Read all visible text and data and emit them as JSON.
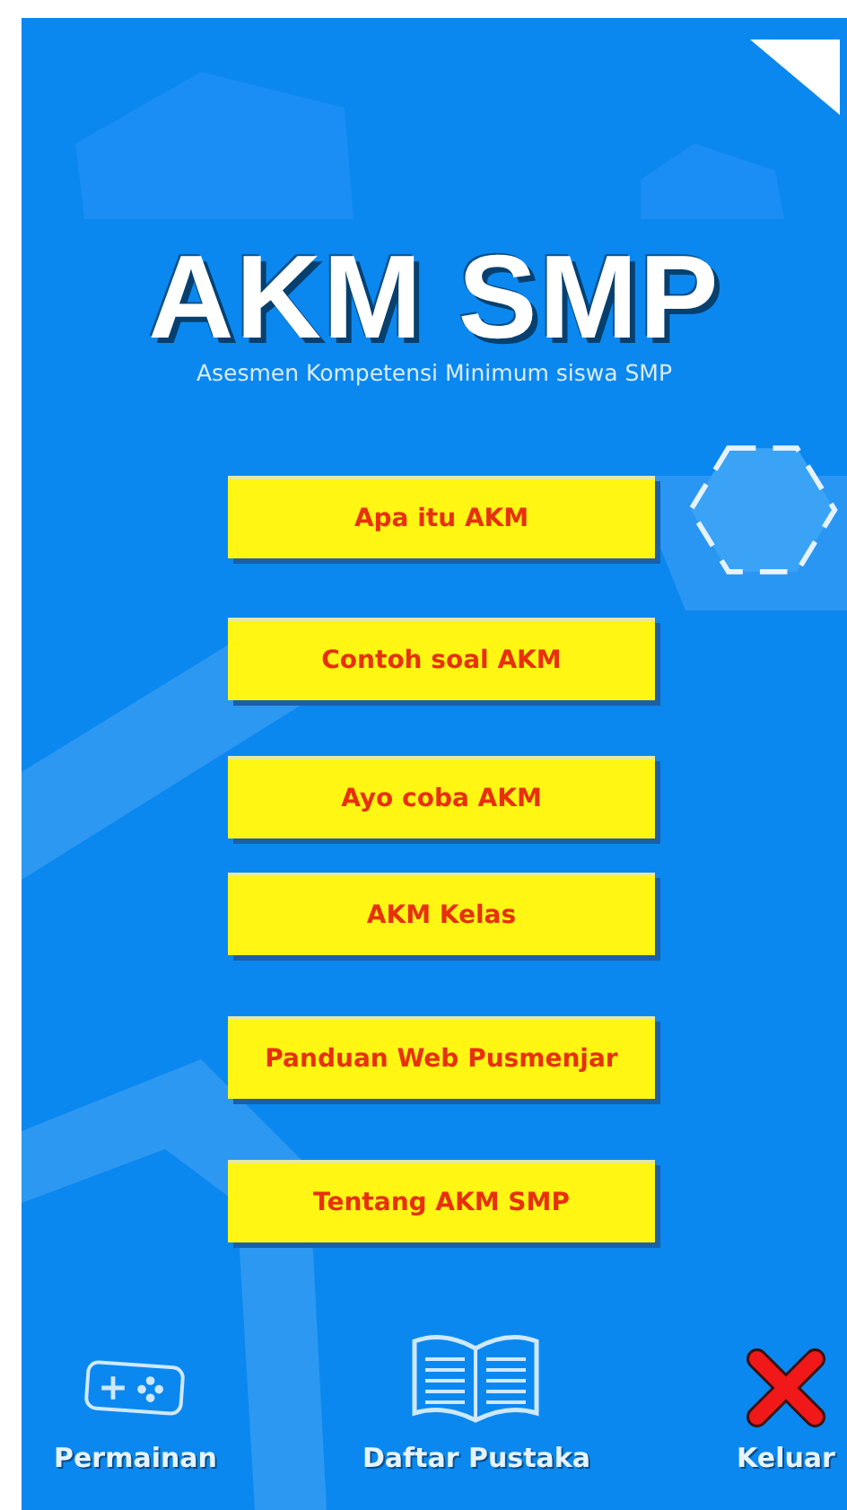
{
  "app": {
    "title": "AKM SMP",
    "subtitle": "Asesmen Kompetensi Minimum siswa SMP"
  },
  "menu": [
    {
      "label": "Apa itu AKM"
    },
    {
      "label": "Contoh soal AKM"
    },
    {
      "label": "Ayo coba AKM"
    },
    {
      "label": "AKM Kelas"
    },
    {
      "label": "Panduan Web Pusmenjar"
    },
    {
      "label": "Tentang AKM SMP"
    }
  ],
  "bottom_bar": [
    {
      "kind": "game",
      "label": "Permainan"
    },
    {
      "kind": "book",
      "label": "Daftar Pustaka"
    },
    {
      "kind": "exit",
      "label": "Keluar"
    }
  ]
}
